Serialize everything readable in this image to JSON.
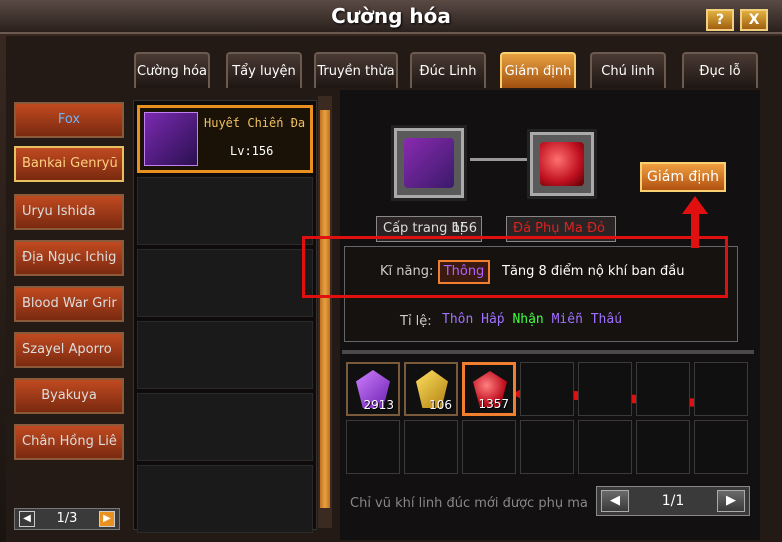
{
  "window": {
    "title": "Cường hóa",
    "help": "?",
    "close": "X"
  },
  "tabs": [
    "Cường hóa",
    "Tẩy luyện",
    "Truyền thừa",
    "Đúc Linh",
    "Giám định",
    "Chú linh",
    "Đục lỗ"
  ],
  "active_tab": "Giám định",
  "characters": [
    "Fox",
    "Bankai Genryū",
    "Uryu Ishida",
    "Địa Ngục Ichig",
    "Blood War Grir",
    "Szayel Aporro",
    "Byakuya",
    "Chân Hồng Liê"
  ],
  "char_pager": {
    "text": "1/3"
  },
  "item": {
    "name": "Huyết Chiến Đa",
    "level": "Lv:156"
  },
  "labels": {
    "cap": "Cấp trang bị",
    "cap_val": "156",
    "gem_name": "Đá Phụ Ma Đỏ"
  },
  "actions": {
    "appraise": "Giám định"
  },
  "skill": {
    "label": "Kĩ năng:",
    "tag": "Thông",
    "desc": "Tăng 8 điểm nộ khí ban đầu"
  },
  "rate": {
    "label": "Tỉ lệ:",
    "parts": [
      "Thôn",
      "Hấp",
      "Nhận",
      "Miễn",
      "Thấu"
    ]
  },
  "inventory": [
    {
      "count": "2913"
    },
    {
      "count": "106"
    },
    {
      "count": "1357"
    }
  ],
  "hint": "Chỉ vũ khí linh đúc mới được phụ ma",
  "inv_pager": {
    "text": "1/1"
  },
  "colors": {
    "accent": "#e89020",
    "red": "#e01010"
  }
}
